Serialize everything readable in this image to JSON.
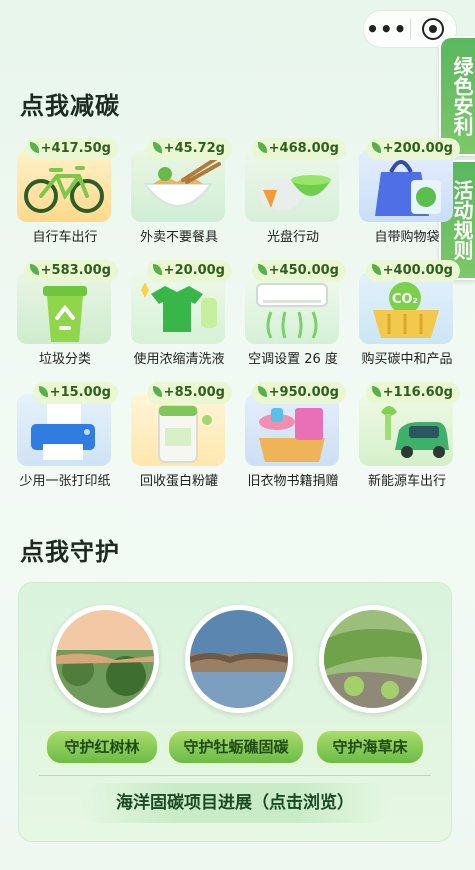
{
  "side_tabs": {
    "green_safety": "绿色安利",
    "rules": "活动规则"
  },
  "reduce": {
    "title": "点我减碳",
    "items": [
      {
        "label": "自行车出行",
        "value": "+417.50g",
        "icon": "bicycle-icon"
      },
      {
        "label": "外卖不要餐具",
        "value": "+45.72g",
        "icon": "noodle-bowl-icon"
      },
      {
        "label": "光盘行动",
        "value": "+468.00g",
        "icon": "empty-plate-icon"
      },
      {
        "label": "自带购物袋",
        "value": "+200.00g",
        "icon": "shopping-bag-icon"
      },
      {
        "label": "垃圾分类",
        "value": "+583.00g",
        "icon": "recycle-bin-icon"
      },
      {
        "label": "使用浓缩清洗液",
        "value": "+20.00g",
        "icon": "detergent-icon"
      },
      {
        "label": "空调设置 26 度",
        "value": "+450.00g",
        "icon": "air-conditioner-icon"
      },
      {
        "label": "购买碳中和产品",
        "value": "+400.00g",
        "icon": "co2-basket-icon"
      },
      {
        "label": "少用一张打印纸",
        "value": "+15.00g",
        "icon": "printer-icon"
      },
      {
        "label": "回收蛋白粉罐",
        "value": "+85.00g",
        "icon": "protein-can-icon"
      },
      {
        "label": "旧衣物书籍捐赠",
        "value": "+950.00g",
        "icon": "donation-box-icon"
      },
      {
        "label": "新能源车出行",
        "value": "+116.60g",
        "icon": "ev-car-icon"
      }
    ]
  },
  "protect": {
    "title": "点我守护",
    "buttons": [
      "守护红树林",
      "守护牡蛎礁固碳",
      "守护海草床"
    ],
    "images": [
      "mangrove-photo",
      "oyster-reef-photo",
      "seagrass-photo"
    ],
    "progress_link": "海洋固碳项目进展（点击浏览）"
  },
  "colors": {
    "accent": "#59b85e",
    "badge_bg": "#e9f7d2",
    "panel_bg": "#d9f3dc"
  }
}
